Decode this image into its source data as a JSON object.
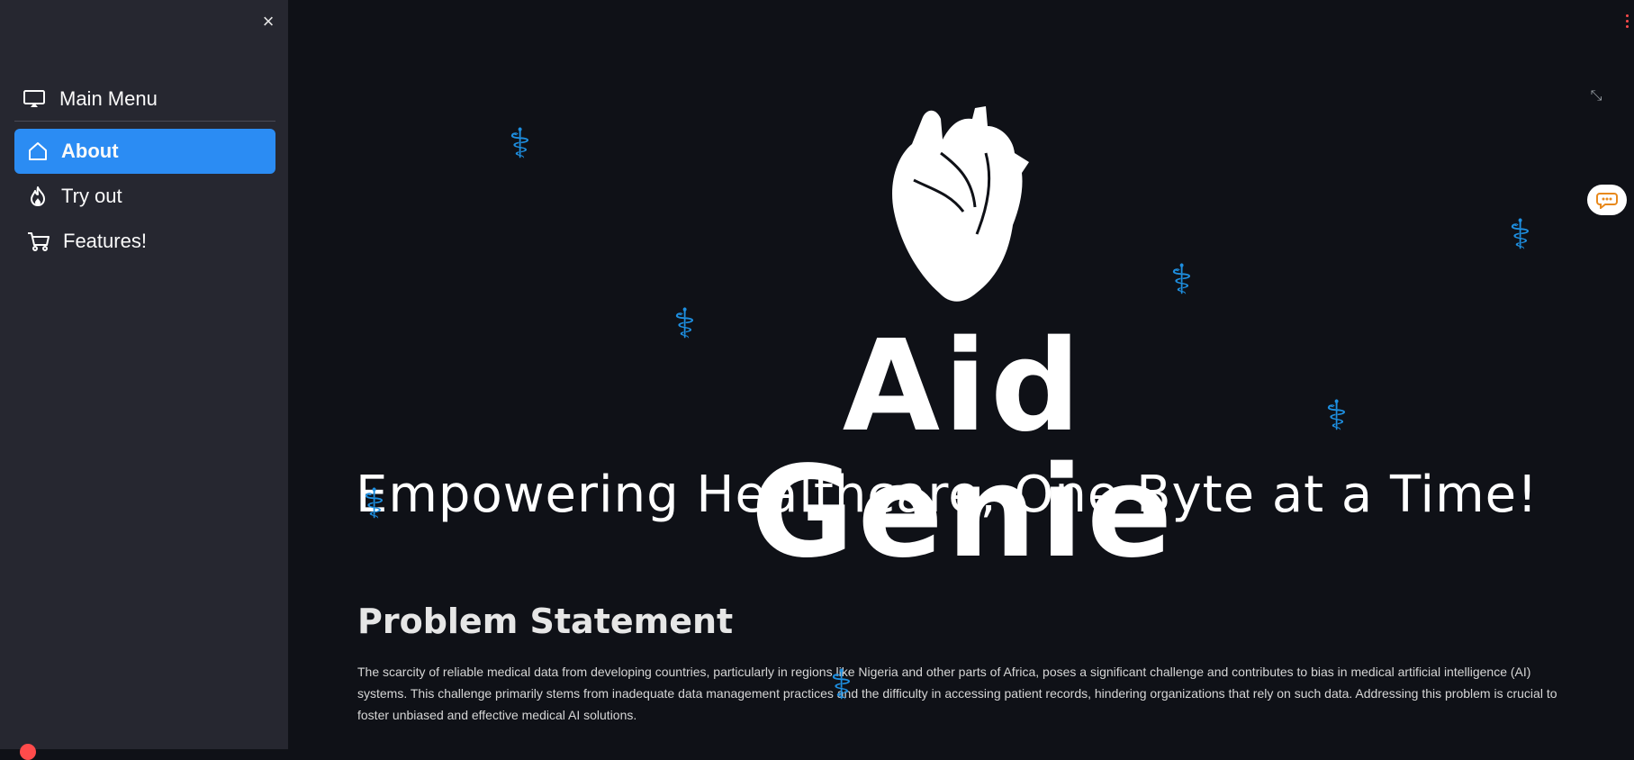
{
  "sidebar": {
    "close_label": "×",
    "menu_title": "Main Menu",
    "items": [
      {
        "label": "About",
        "icon": "house-icon",
        "active": true
      },
      {
        "label": "Try out",
        "icon": "fire-icon",
        "active": false
      },
      {
        "label": "Features!",
        "icon": "cart-icon",
        "active": false
      }
    ]
  },
  "hero": {
    "brand": "Aid Genie",
    "tagline": "Empowering Healthcare, One Byte at a Time!"
  },
  "section": {
    "title": "Problem Statement",
    "body": "The scarcity of reliable medical data from developing countries, particularly in regions like Nigeria and other parts of Africa, poses a significant challenge and contributes to bias in medical artificial intelligence (AI) systems. This challenge primarily stems from inadequate data management practices and the difficulty in accessing patient records, hindering organizations that rely on such data. Addressing this problem is crucial to foster unbiased and effective medical AI solutions."
  },
  "colors": {
    "accent": "#2b8cf3",
    "sidebar_bg": "#262730",
    "main_bg": "#0f1117",
    "symbol": "#1e8fe0"
  },
  "icons": {
    "expand": "expand-icon",
    "chat": "chat-icon",
    "menu_title": "monitor-icon",
    "decor": "caduceus-icon"
  }
}
